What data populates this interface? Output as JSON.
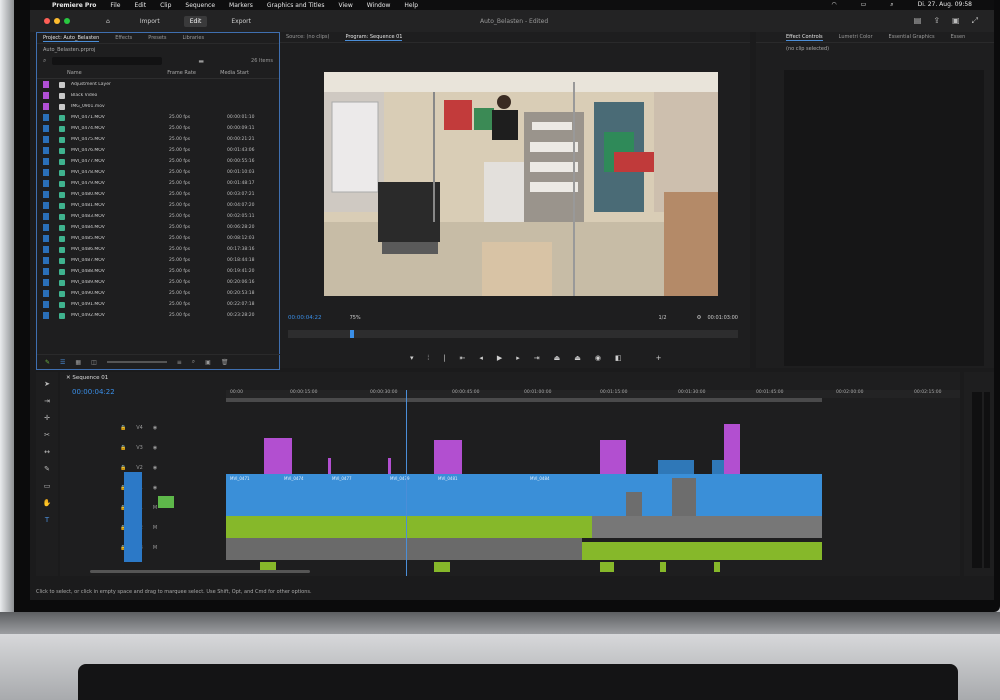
{
  "menubar": {
    "app": "Premiere Pro",
    "items": [
      "File",
      "Edit",
      "Clip",
      "Sequence",
      "Markers",
      "Graphics and Titles",
      "View",
      "Window",
      "Help"
    ],
    "datetime": "Di. 27. Aug. 09:58"
  },
  "header": {
    "tabs": [
      {
        "label": "Import"
      },
      {
        "label": "Edit"
      },
      {
        "label": "Export"
      }
    ],
    "title": "Auto_Belasten - Edited"
  },
  "project": {
    "tabs": [
      "Project: Auto_Belasten",
      "Effects",
      "Presets",
      "Libraries"
    ],
    "file": "Auto_Belasten.prproj",
    "items_count": "26 Items",
    "columns": [
      "Name",
      "Frame Rate",
      "Media Start"
    ],
    "rows": [
      {
        "name": "Adjustment Layer",
        "fps": "",
        "start": "",
        "color": "#b04fd6"
      },
      {
        "name": "Black Video",
        "fps": "",
        "start": "",
        "color": "#b04fd6"
      },
      {
        "name": "IMG_0901.mov",
        "fps": "",
        "start": "",
        "color": "#b04fd6"
      },
      {
        "name": "MVI_0471.MOV",
        "fps": "25.00 fps",
        "start": "00:00:01:10",
        "color": "#2a6fb8"
      },
      {
        "name": "MVI_0474.MOV",
        "fps": "25.00 fps",
        "start": "00:00:09:11",
        "color": "#2a6fb8"
      },
      {
        "name": "MVI_0475.MOV",
        "fps": "25.00 fps",
        "start": "00:00:21:21",
        "color": "#2a6fb8"
      },
      {
        "name": "MVI_0476.MOV",
        "fps": "25.00 fps",
        "start": "00:01:43:06",
        "color": "#2a6fb8"
      },
      {
        "name": "MVI_0477.MOV",
        "fps": "25.00 fps",
        "start": "00:00:55:16",
        "color": "#2a6fb8"
      },
      {
        "name": "MVI_0478.MOV",
        "fps": "25.00 fps",
        "start": "00:01:10:03",
        "color": "#2a6fb8"
      },
      {
        "name": "MVI_0479.MOV",
        "fps": "25.00 fps",
        "start": "00:01:48:17",
        "color": "#2a6fb8"
      },
      {
        "name": "MVI_0480.MOV",
        "fps": "25.00 fps",
        "start": "00:03:07:21",
        "color": "#2a6fb8"
      },
      {
        "name": "MVI_0481.MOV",
        "fps": "25.00 fps",
        "start": "00:04:07:20",
        "color": "#2a6fb8"
      },
      {
        "name": "MVI_0483.MOV",
        "fps": "25.00 fps",
        "start": "00:02:05:11",
        "color": "#2a6fb8"
      },
      {
        "name": "MVI_0484.MOV",
        "fps": "25.00 fps",
        "start": "00:06:28:20",
        "color": "#2a6fb8"
      },
      {
        "name": "MVI_0485.MOV",
        "fps": "25.00 fps",
        "start": "00:08:12:03",
        "color": "#2a6fb8"
      },
      {
        "name": "MVI_0486.MOV",
        "fps": "25.00 fps",
        "start": "00:17:38:16",
        "color": "#2a6fb8"
      },
      {
        "name": "MVI_0487.MOV",
        "fps": "25.00 fps",
        "start": "00:18:44:18",
        "color": "#2a6fb8"
      },
      {
        "name": "MVI_0488.MOV",
        "fps": "25.00 fps",
        "start": "00:19:41:20",
        "color": "#2a6fb8"
      },
      {
        "name": "MVI_0489.MOV",
        "fps": "25.00 fps",
        "start": "00:20:06:16",
        "color": "#2a6fb8"
      },
      {
        "name": "MVI_0490.MOV",
        "fps": "25.00 fps",
        "start": "00:20:53:18",
        "color": "#2a6fb8"
      },
      {
        "name": "MVI_0491.MOV",
        "fps": "25.00 fps",
        "start": "00:22:07:18",
        "color": "#2a6fb8"
      },
      {
        "name": "MVI_0492.MOV",
        "fps": "25.00 fps",
        "start": "00:23:28:20",
        "color": "#2a6fb8"
      }
    ]
  },
  "program": {
    "tabs": [
      "Source: (no clips)",
      "Program: Sequence 01"
    ],
    "timecode": "00:00:04:22",
    "fit": "75%",
    "quality": "1/2",
    "duration": "00:01:03:00"
  },
  "effect_controls": {
    "tabs": [
      "Effect Controls",
      "Lumetri Color",
      "Essential Graphics",
      "Essen"
    ],
    "note": "(no clip selected)"
  },
  "timeline": {
    "tab": "Sequence 01",
    "timecode": "00:00:04:22",
    "ruler": [
      "00:00",
      "00:00:15:00",
      "00:00:30:00",
      "00:00:45:00",
      "00:01:00:00",
      "00:01:15:00",
      "00:01:30:00",
      "00:01:45:00",
      "00:02:00:00",
      "00:02:15:00"
    ],
    "video_tracks": [
      "V4",
      "V3",
      "V2",
      "V1"
    ],
    "audio_tracks": [
      "A1",
      "A2",
      "A3"
    ],
    "clip_labels": [
      "MVI_0471",
      "MVI_0474",
      "MVI_0477",
      "MVI_0479",
      "MVI_0481",
      "MVI_0484"
    ]
  },
  "status": "Click to select, or click in empty space and drag to marquee select. Use Shift, Opt, and Cmd for other options."
}
